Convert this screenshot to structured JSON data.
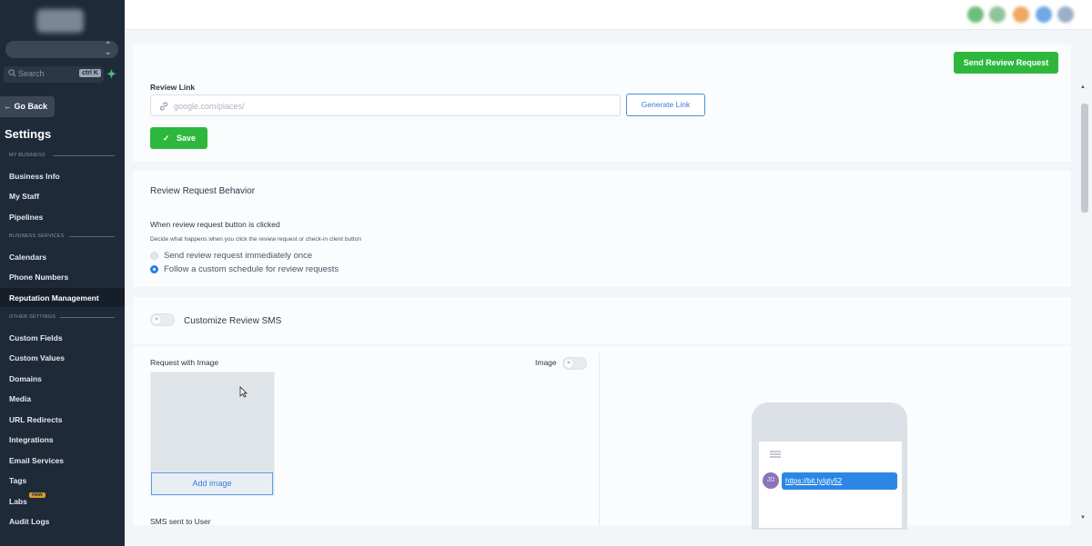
{
  "sidebar": {
    "search_label": "Search",
    "search_shortcut": "ctrl K",
    "go_back_label": "Go Back",
    "title": "Settings",
    "sections": {
      "my_business": "MY BUSINESS",
      "business_services": "BUSINESS SERVICES",
      "other_settings": "OTHER SETTINGS"
    },
    "items": [
      {
        "label": "Business Info"
      },
      {
        "label": "My Staff"
      },
      {
        "label": "Pipelines"
      },
      {
        "label": "Calendars"
      },
      {
        "label": "Phone Numbers"
      },
      {
        "label": "Reputation Management",
        "active": true
      },
      {
        "label": "Custom Fields"
      },
      {
        "label": "Custom Values"
      },
      {
        "label": "Domains"
      },
      {
        "label": "Media"
      },
      {
        "label": "URL Redirects"
      },
      {
        "label": "Integrations"
      },
      {
        "label": "Email Services"
      },
      {
        "label": "Tags"
      },
      {
        "label": "Labs"
      },
      {
        "label": "Audit Logs"
      }
    ],
    "labs_badge": "new"
  },
  "header": {
    "send_review_request_label": "Send Review Request"
  },
  "review_link": {
    "label": "Review Link",
    "placeholder": "google.com/places/",
    "generate_label": "Generate Link",
    "save_label": "Save"
  },
  "behavior": {
    "title": "Review Request Behavior",
    "question": "When review request button is clicked",
    "description": "Decide what happens when you click the review request or check-in client button",
    "options": [
      {
        "label": "Send review request immediately once",
        "selected": false
      },
      {
        "label": "Follow a custom schedule for review requests",
        "selected": true
      }
    ]
  },
  "sms": {
    "toggle_label": "Customize Review SMS",
    "request_with_image_label": "Request with Image",
    "image_toggle_label": "Image",
    "add_image_label": "Add image",
    "sms_sent_label": "SMS sent to User",
    "preview": {
      "avatar_initials": "JD",
      "message_link": "https://bit.ly/gty52"
    }
  },
  "colors": {
    "sidebar_bg": "#1f2a38",
    "primary_green": "#2db83d",
    "accent_blue": "#2b86e6"
  }
}
